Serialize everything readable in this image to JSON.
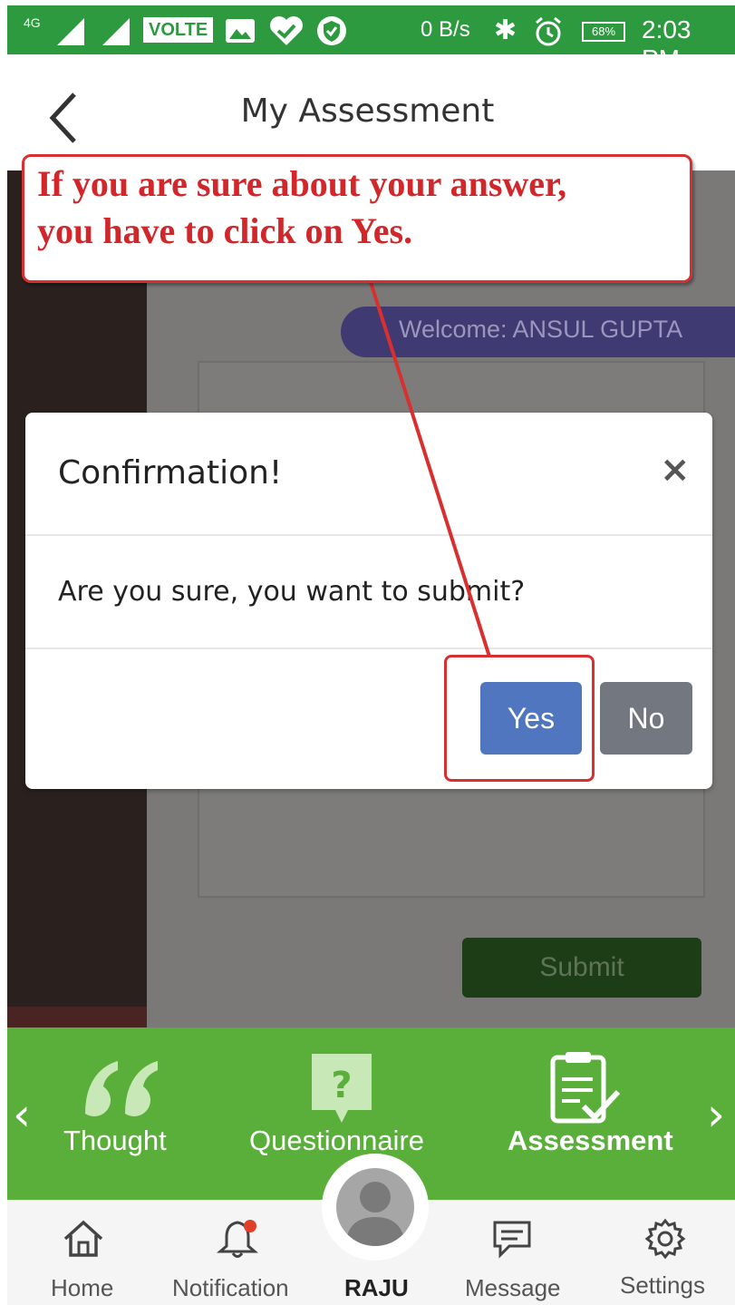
{
  "status_bar": {
    "network": "4G",
    "volte": "VOLTE",
    "data_speed": "0 B/s",
    "battery": "68%",
    "time": "2:03 PM"
  },
  "header": {
    "title": "My Assessment"
  },
  "background": {
    "welcome": "Welcome: ANSUL GUPTA",
    "submit_label": "Submit"
  },
  "modal": {
    "title": "Confirmation!",
    "close_symbol": "×",
    "message": "Are you sure, you want to submit?",
    "yes_label": "Yes",
    "no_label": "No",
    "yes_color": "#4f76bf",
    "no_color": "#737780"
  },
  "annotation": {
    "line1": "If you are sure about your answer,",
    "line2": "you have to click on Yes.",
    "color": "#d1262a"
  },
  "module_nav": {
    "prev_arrow": "‹",
    "next_arrow": "›",
    "items": [
      {
        "label": "Thought",
        "icon": "quote-icon"
      },
      {
        "label": "Questionnaire",
        "icon": "question-icon"
      },
      {
        "label": "Assessment",
        "icon": "clipboard-check-icon"
      }
    ],
    "background": "#5aaf3b"
  },
  "bottom_nav": {
    "items": [
      {
        "label": "Home",
        "icon": "home-icon"
      },
      {
        "label": "Notification",
        "icon": "bell-icon"
      },
      {
        "label": "RAJU",
        "icon": "avatar"
      },
      {
        "label": "Message",
        "icon": "chat-icon"
      },
      {
        "label": "Settings",
        "icon": "gear-icon"
      }
    ]
  }
}
